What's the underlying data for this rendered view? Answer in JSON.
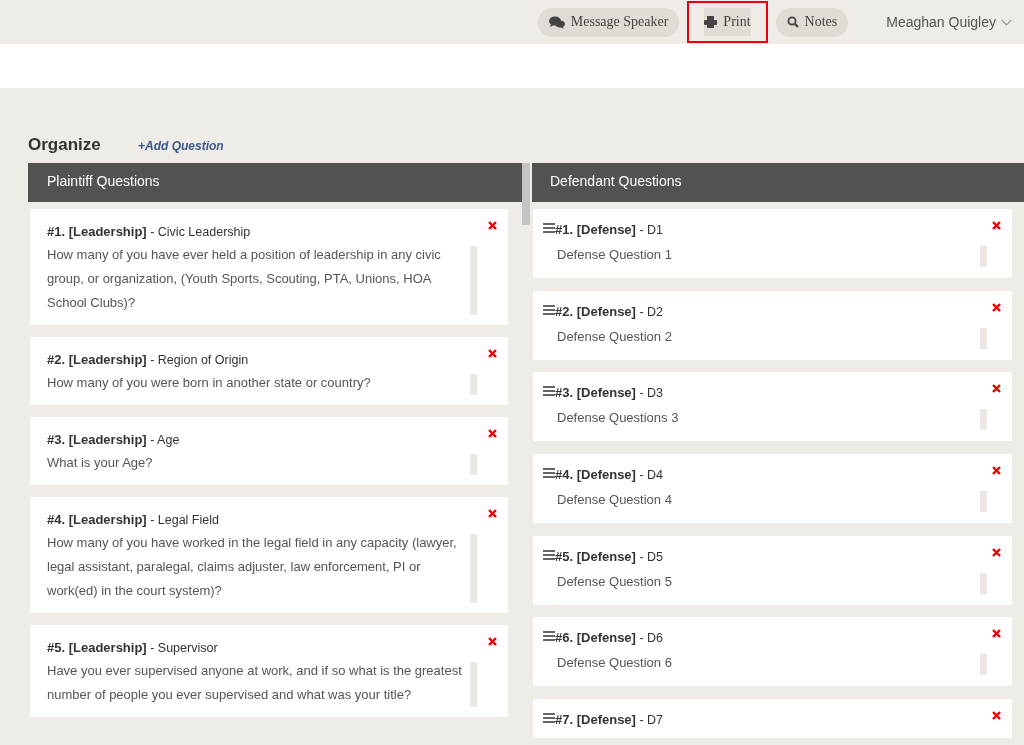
{
  "top_bar": {
    "buttons": [
      {
        "kind": "message",
        "label": "Message Speaker",
        "highlighted": false
      },
      {
        "kind": "print",
        "label": "Print",
        "highlighted": true
      },
      {
        "kind": "notes",
        "label": "Notes",
        "highlighted": false
      }
    ],
    "user": "Meaghan Quigley"
  },
  "organize": {
    "title": "Organize",
    "add_link": "+Add Question"
  },
  "columns": [
    {
      "title": "Plaintiff Questions",
      "draggable": false,
      "questions": [
        {
          "title": "**#1. [Leadership]** - Civic Leadership",
          "text": "How many of you have ever held a position of leadership in any civic group, or organization, (Youth Sports, Scouting, PTA, Unions, HOA School Clubs)?"
        },
        {
          "title": "**#2. [Leadership]** - Region of Origin",
          "text": "How many of you were born in another state or country?"
        },
        {
          "title": "**#3. [Leadership]** - Age",
          "text": "What is your Age?"
        },
        {
          "title": "**#4. [Leadership]** - Legal Field",
          "text": "How many of you have worked in the legal field in any capacity (lawyer, legal assistant, paralegal, claims adjuster, law enforcement, PI or work(ed) in the court system)?"
        },
        {
          "title": "**#5. [Leadership]** - Supervisor",
          "text": "Have you ever supervised anyone at work, and if so what is the greatest number of people you ever supervised and what was your title?"
        }
      ]
    },
    {
      "title": "Defendant Questions",
      "draggable": true,
      "questions": [
        {
          "title": "**#1. [Defense]** - D1",
          "text": "Defense Question 1"
        },
        {
          "title": "**#2. [Defense]** - D2",
          "text": "Defense Question 2"
        },
        {
          "title": "**#3. [Defense]** - D3",
          "text": "Defense Questions 3"
        },
        {
          "title": "**#4. [Defense]** - D4",
          "text": "Defense Question 4"
        },
        {
          "title": "**#5. [Defense]** - D5",
          "text": "Defense Question 5"
        },
        {
          "title": "**#6. [Defense]** - D6",
          "text": "Defense Question 6"
        },
        {
          "title": "**#7. [Defense]** - D7"
        }
      ]
    }
  ]
}
